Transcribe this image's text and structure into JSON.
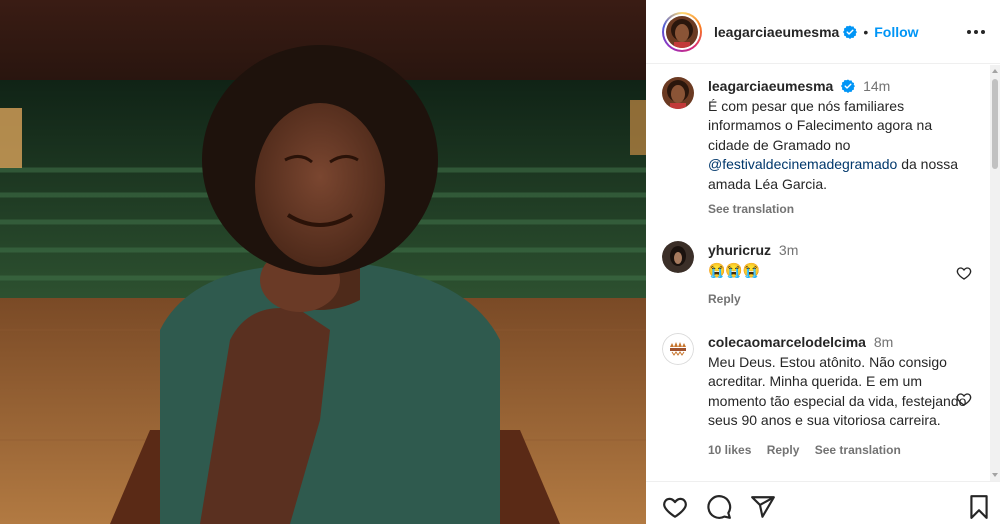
{
  "post": {
    "username": "leagarciaeumesma",
    "follow_label": "Follow",
    "separator": "•",
    "caption": {
      "time": "14m",
      "text_before": "É com pesar que nós familiares informamos o Falecimento agora na cidade de Gramado no ",
      "mention": "@festivaldecinemadegramado",
      "text_after": " da nossa amada Léa Garcia.",
      "see_translation": "See translation"
    }
  },
  "comments": [
    {
      "username": "yhuricruz",
      "time": "3m",
      "text": "😭😭😭",
      "reply_label": "Reply"
    },
    {
      "username": "colecaomarcelodelcima",
      "time": "8m",
      "text": "Meu Deus. Estou atônito. Não consigo acreditar. Minha querida. E em um momento tão especial da vida, festejando seus 90 anos e sua vitoriosa carreira.",
      "likes_label": "10 likes",
      "reply_label": "Reply",
      "see_translation": "See translation"
    }
  ],
  "icons": {
    "verified": "verified-badge-icon",
    "more": "more-options-icon",
    "like": "heart-icon",
    "comment": "comment-icon",
    "share": "share-icon",
    "save": "bookmark-icon"
  },
  "colors": {
    "link_blue": "#0095f6",
    "mention_blue": "#00376b",
    "secondary_text": "#737373",
    "text": "#262626"
  }
}
